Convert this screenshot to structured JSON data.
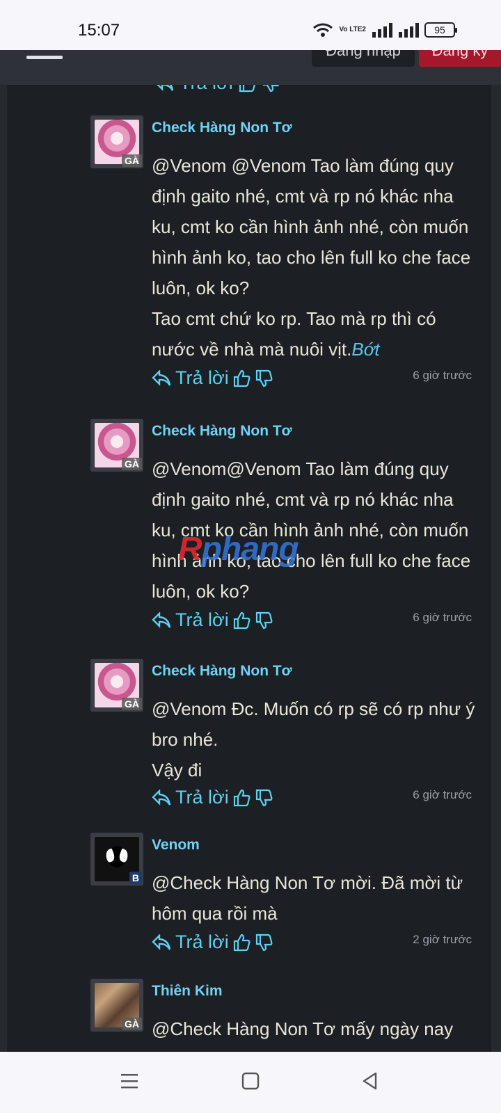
{
  "status": {
    "time": "15:07",
    "battery": "95",
    "network": "Vo LTE2"
  },
  "header": {
    "login_label": "Đăng nhập",
    "register_label": "Đăng ký"
  },
  "partial": {
    "reply_label": "Trả lời"
  },
  "comments": [
    {
      "user": "Check Hàng Non Tơ",
      "badge": "GÀ",
      "lines": [
        "@Venom @Venom Tao làm đúng quy định gaito nhé, cmt và rp nó khác nha ku, cmt ko cần hình ảnh nhé, còn muốn hình ảnh ko, tao cho lên full ko che face luôn, ok ko?",
        "Tao cmt chứ ko rp. Tao mà rp thì có nước về nhà mà nuôi vịt."
      ],
      "more_label": "Bớt",
      "reply_label": "Trả lời",
      "time": "6 giờ trước"
    },
    {
      "user": "Check Hàng Non Tơ",
      "badge": "GÀ",
      "lines": [
        "@Venom@Venom Tao làm đúng quy định gaito nhé, cmt và rp nó khác nha ku, cmt ko cần hình ảnh nhé, còn muốn hình ảnh ko, tao cho lên full ko che face luôn, ok ko?"
      ],
      "reply_label": "Trả lời",
      "time": "6 giờ trước"
    },
    {
      "user": "Check Hàng Non Tơ",
      "badge": "GÀ",
      "lines": [
        "@Venom Đc. Muốn có rp sẽ có rp như ý bro nhé.",
        "Vậy đi"
      ],
      "reply_label": "Trả lời",
      "time": "6 giờ trước"
    },
    {
      "user": "Venom",
      "badge": "B",
      "lines": [
        "@Check Hàng Non Tơ mời. Đã mời từ hôm qua rồi mà"
      ],
      "reply_label": "Trả lời",
      "time": "2 giờ trước"
    },
    {
      "user": "Thiên Kim",
      "badge": "GÀ",
      "lines": [
        "@Check Hàng Non Tơ mấy ngày nay"
      ]
    }
  ],
  "watermark": {
    "prefix": "R",
    "rest": "phang"
  }
}
